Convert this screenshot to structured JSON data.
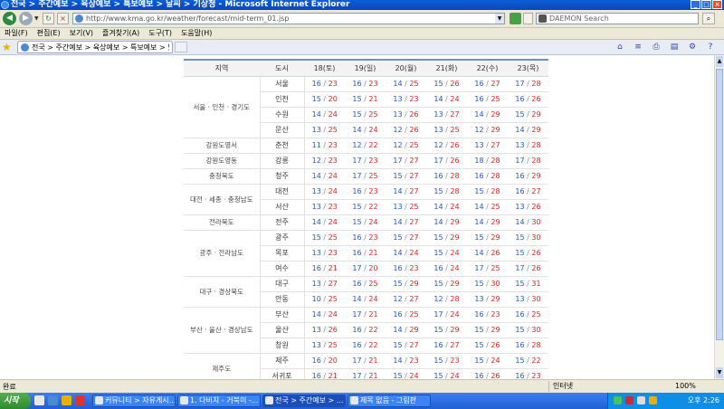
{
  "window": {
    "title": "전국 > 주간예보 > 육상예보 > 특보예보 > 날씨 > 기상청 - Microsoft Internet Explorer"
  },
  "address": {
    "url": "http://www.kma.go.kr/weather/forecast/mid-term_01.jsp"
  },
  "search": {
    "placeholder": "DAEMON Search"
  },
  "menu": [
    "파일(F)",
    "편집(E)",
    "보기(V)",
    "즐겨찾기(A)",
    "도구(T)",
    "도움말(H)"
  ],
  "tab": {
    "title": "전국 > 주간예보 > 육상예보 > 특보예보 > 날..."
  },
  "table": {
    "headers": [
      "지역",
      "도시",
      "18(토)",
      "19(일)",
      "20(월)",
      "21(화)",
      "22(수)",
      "23(목)"
    ],
    "groups": [
      {
        "region": "서울 · 인천 · 경기도",
        "rows": [
          {
            "city": "서울",
            "temps": [
              [
                "16",
                "23"
              ],
              [
                "16",
                "23"
              ],
              [
                "14",
                "25"
              ],
              [
                "15",
                "26"
              ],
              [
                "16",
                "27"
              ],
              [
                "17",
                "28"
              ]
            ]
          },
          {
            "city": "인천",
            "temps": [
              [
                "15",
                "20"
              ],
              [
                "15",
                "21"
              ],
              [
                "13",
                "23"
              ],
              [
                "14",
                "24"
              ],
              [
                "16",
                "25"
              ],
              [
                "16",
                "26"
              ]
            ]
          },
          {
            "city": "수원",
            "temps": [
              [
                "14",
                "24"
              ],
              [
                "15",
                "25"
              ],
              [
                "13",
                "26"
              ],
              [
                "13",
                "27"
              ],
              [
                "14",
                "29"
              ],
              [
                "15",
                "29"
              ]
            ]
          },
          {
            "city": "문산",
            "temps": [
              [
                "13",
                "25"
              ],
              [
                "14",
                "24"
              ],
              [
                "12",
                "26"
              ],
              [
                "13",
                "25"
              ],
              [
                "12",
                "29"
              ],
              [
                "14",
                "29"
              ]
            ]
          }
        ]
      },
      {
        "region": "강원도영서",
        "rows": [
          {
            "city": "춘천",
            "temps": [
              [
                "11",
                "23"
              ],
              [
                "12",
                "22"
              ],
              [
                "12",
                "25"
              ],
              [
                "12",
                "26"
              ],
              [
                "13",
                "27"
              ],
              [
                "13",
                "28"
              ]
            ]
          }
        ]
      },
      {
        "region": "강원도영동",
        "rows": [
          {
            "city": "강릉",
            "temps": [
              [
                "12",
                "23"
              ],
              [
                "17",
                "23"
              ],
              [
                "17",
                "27"
              ],
              [
                "17",
                "26"
              ],
              [
                "18",
                "28"
              ],
              [
                "17",
                "28"
              ]
            ]
          }
        ]
      },
      {
        "region": "충청북도",
        "rows": [
          {
            "city": "청주",
            "temps": [
              [
                "14",
                "24"
              ],
              [
                "17",
                "25"
              ],
              [
                "15",
                "27"
              ],
              [
                "16",
                "28"
              ],
              [
                "16",
                "28"
              ],
              [
                "16",
                "29"
              ]
            ]
          }
        ]
      },
      {
        "region": "대전 · 세종 · 충청남도",
        "rows": [
          {
            "city": "대전",
            "temps": [
              [
                "13",
                "24"
              ],
              [
                "16",
                "23"
              ],
              [
                "14",
                "27"
              ],
              [
                "15",
                "28"
              ],
              [
                "15",
                "28"
              ],
              [
                "16",
                "27"
              ]
            ]
          },
          {
            "city": "서산",
            "temps": [
              [
                "13",
                "23"
              ],
              [
                "15",
                "22"
              ],
              [
                "13",
                "25"
              ],
              [
                "14",
                "24"
              ],
              [
                "14",
                "25"
              ],
              [
                "13",
                "26"
              ]
            ]
          }
        ]
      },
      {
        "region": "전라북도",
        "rows": [
          {
            "city": "전주",
            "temps": [
              [
                "14",
                "24"
              ],
              [
                "15",
                "24"
              ],
              [
                "14",
                "27"
              ],
              [
                "14",
                "29"
              ],
              [
                "14",
                "29"
              ],
              [
                "14",
                "30"
              ]
            ]
          }
        ]
      },
      {
        "region": "광주 · 전라남도",
        "rows": [
          {
            "city": "광주",
            "temps": [
              [
                "15",
                "25"
              ],
              [
                "16",
                "23"
              ],
              [
                "15",
                "27"
              ],
              [
                "15",
                "29"
              ],
              [
                "15",
                "29"
              ],
              [
                "15",
                "30"
              ]
            ]
          },
          {
            "city": "목포",
            "temps": [
              [
                "13",
                "23"
              ],
              [
                "16",
                "21"
              ],
              [
                "14",
                "24"
              ],
              [
                "15",
                "24"
              ],
              [
                "14",
                "26"
              ],
              [
                "15",
                "26"
              ]
            ]
          },
          {
            "city": "여수",
            "temps": [
              [
                "16",
                "21"
              ],
              [
                "17",
                "20"
              ],
              [
                "16",
                "23"
              ],
              [
                "16",
                "24"
              ],
              [
                "17",
                "25"
              ],
              [
                "17",
                "26"
              ]
            ]
          }
        ]
      },
      {
        "region": "대구 · 경상북도",
        "rows": [
          {
            "city": "대구",
            "temps": [
              [
                "13",
                "27"
              ],
              [
                "16",
                "25"
              ],
              [
                "15",
                "29"
              ],
              [
                "15",
                "29"
              ],
              [
                "15",
                "30"
              ],
              [
                "15",
                "31"
              ]
            ]
          },
          {
            "city": "안동",
            "temps": [
              [
                "10",
                "25"
              ],
              [
                "14",
                "24"
              ],
              [
                "12",
                "27"
              ],
              [
                "12",
                "28"
              ],
              [
                "13",
                "29"
              ],
              [
                "13",
                "30"
              ]
            ]
          }
        ]
      },
      {
        "region": "부산 · 울산 · 경상남도",
        "rows": [
          {
            "city": "부산",
            "temps": [
              [
                "14",
                "24"
              ],
              [
                "17",
                "21"
              ],
              [
                "16",
                "25"
              ],
              [
                "17",
                "24"
              ],
              [
                "16",
                "23"
              ],
              [
                "16",
                "25"
              ]
            ]
          },
          {
            "city": "울산",
            "temps": [
              [
                "13",
                "26"
              ],
              [
                "16",
                "22"
              ],
              [
                "14",
                "29"
              ],
              [
                "15",
                "29"
              ],
              [
                "15",
                "29"
              ],
              [
                "15",
                "30"
              ]
            ]
          },
          {
            "city": "창원",
            "temps": [
              [
                "13",
                "25"
              ],
              [
                "16",
                "22"
              ],
              [
                "15",
                "27"
              ],
              [
                "16",
                "27"
              ],
              [
                "15",
                "26"
              ],
              [
                "16",
                "28"
              ]
            ]
          }
        ]
      },
      {
        "region": "제주도",
        "rows": [
          {
            "city": "제주",
            "temps": [
              [
                "16",
                "20"
              ],
              [
                "17",
                "21"
              ],
              [
                "14",
                "23"
              ],
              [
                "15",
                "23"
              ],
              [
                "15",
                "24"
              ],
              [
                "15",
                "22"
              ]
            ]
          },
          {
            "city": "서귀포",
            "temps": [
              [
                "16",
                "21"
              ],
              [
                "17",
                "21"
              ],
              [
                "15",
                "24"
              ],
              [
                "15",
                "24"
              ],
              [
                "16",
                "26"
              ],
              [
                "16",
                "23"
              ]
            ]
          }
        ]
      }
    ]
  },
  "statusbar": {
    "text": "완료",
    "zone": "인터넷",
    "zoom": "100%"
  },
  "taskbar": {
    "start": "시작",
    "tasks": [
      {
        "label": "커뮤니티 > 자유게시..."
      },
      {
        "label": "1. 다비치 - 거북이 -..."
      },
      {
        "label": "전국 > 주간예보 > ..."
      },
      {
        "label": "제목 없음 - 그림판"
      }
    ],
    "clock": "오후 2:26"
  }
}
